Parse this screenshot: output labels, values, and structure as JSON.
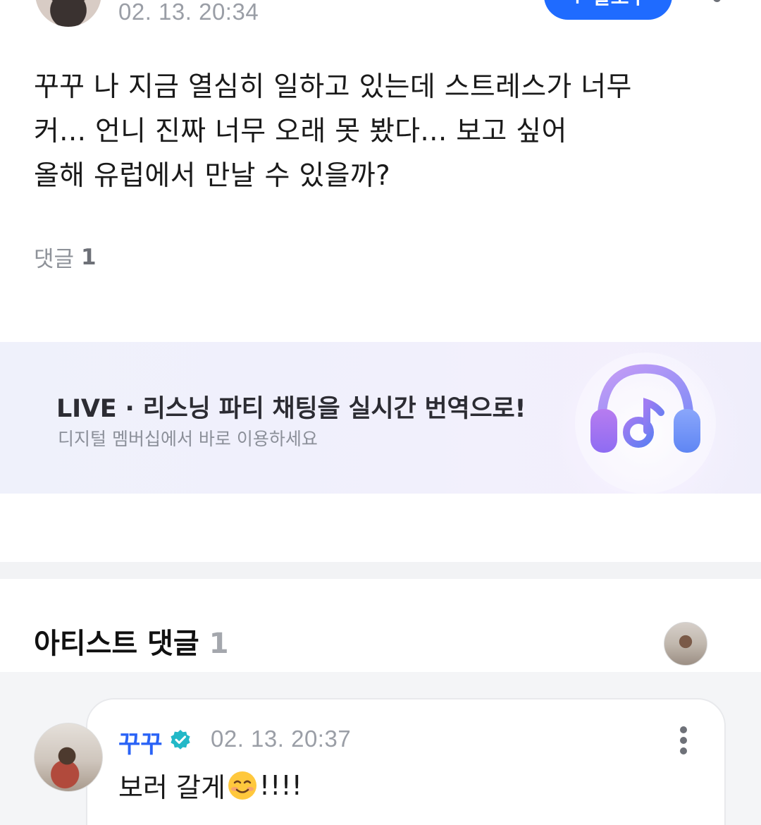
{
  "post": {
    "date": "02. 13. 20:34",
    "follow_button_label": "+ 팔로우",
    "body": "꾸꾸 나 지금 열심히 일하고 있는데 스트레스가 너무\n커... 언니 진짜 너무 오래 못 봤다... 보고 싶어\n올해 유럽에서 만날 수 있을까?",
    "comment_label": "댓글",
    "comment_count": "1"
  },
  "promo": {
    "title": "LIVE · 리스닝 파티 채팅을 실시간 번역으로!",
    "subtitle": "디지털 멤버십에서 바로 이용하세요",
    "icon": "headphones-music-icon"
  },
  "artist_comments": {
    "title": "아티스트 댓글",
    "count": "1",
    "comments": [
      {
        "author": "꾸꾸",
        "verified": true,
        "date": "02. 13. 20:37",
        "text_before": "보러 갈게",
        "emoji": "smiling-face-icon",
        "text_after": "!!!!"
      }
    ]
  },
  "colors": {
    "accent_blue": "#1f6bff",
    "author_blue": "#2a63f6",
    "verified_teal": "#22b8c7",
    "muted_text": "#9a9ea6"
  }
}
